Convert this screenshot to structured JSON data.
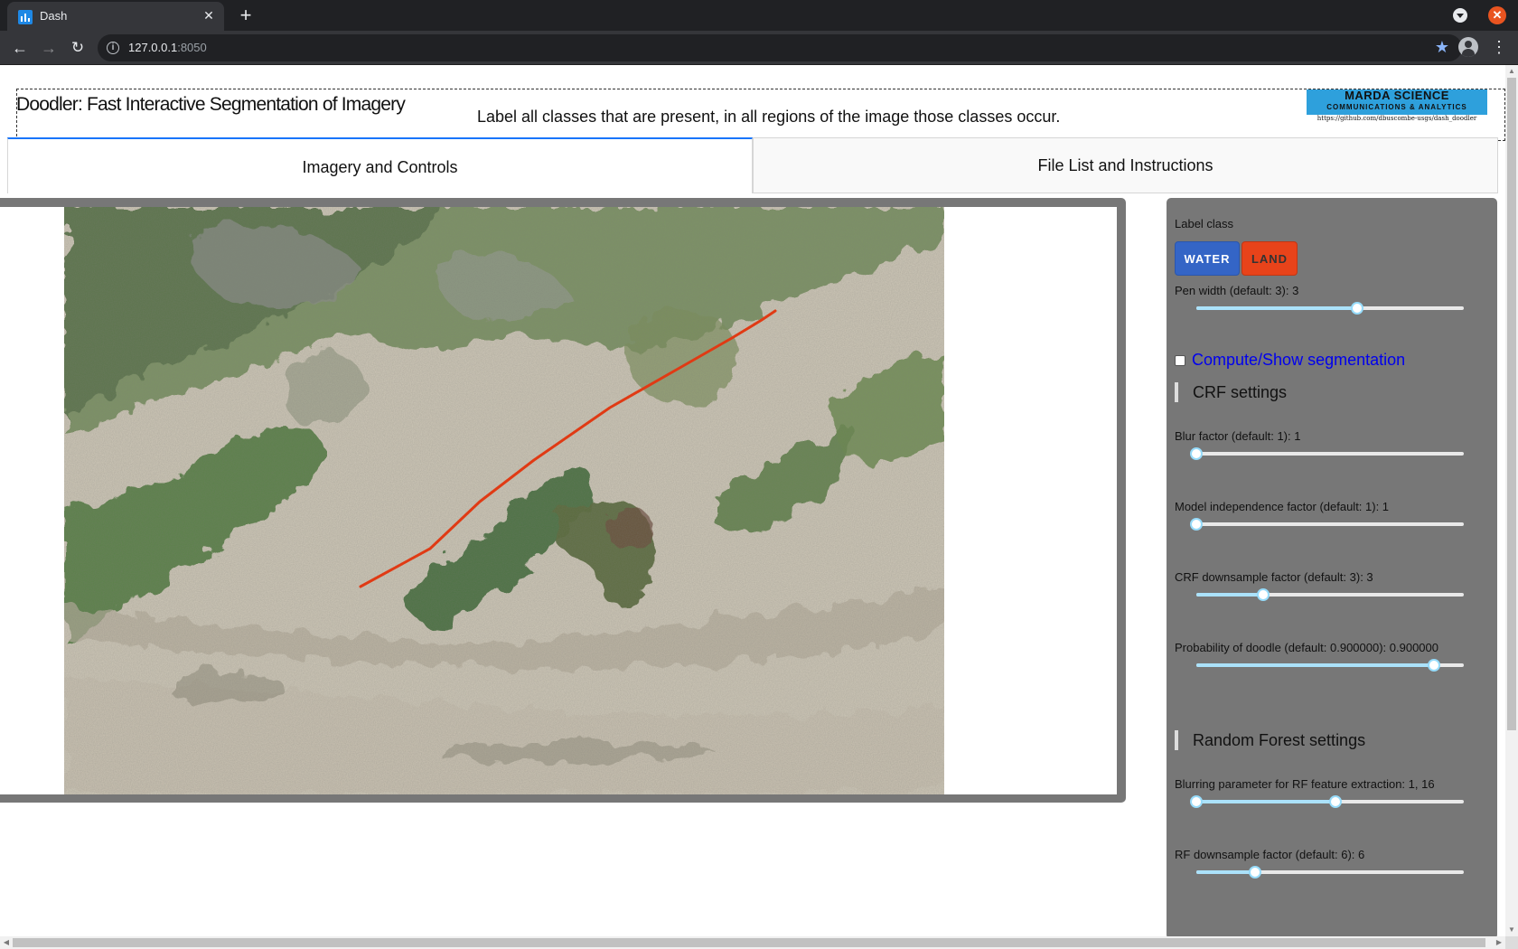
{
  "browser": {
    "tab_title": "Dash",
    "tab_close": "✕",
    "new_tab": "+",
    "url_host": "127.0.0.1",
    "url_port": ":8050"
  },
  "header": {
    "title": "Doodler: Fast Interactive Segmentation of Imagery",
    "instructions": "Label all classes that are present, in all regions of the image those classes occur.",
    "logo_line1": "MARDA SCIENCE",
    "logo_line2": "COMMUNICATIONS & ANALYTICS",
    "logo_url": "https://github.com/dbuscombe-usgs/dash_doodler"
  },
  "tabs": [
    {
      "label": "Imagery and Controls",
      "selected": true
    },
    {
      "label": "File List and Instructions",
      "selected": false
    }
  ],
  "controls": {
    "label_class_title": "Label class",
    "classes": [
      {
        "label": "WATER",
        "color": "#3465c6"
      },
      {
        "label": "LAND",
        "color": "#e8431a"
      }
    ],
    "pen_width": {
      "label": "Pen width (default: 3): 3",
      "fraction": 0.6
    },
    "compute_segmentation": {
      "label": "Compute/Show segmentation",
      "checked": false
    },
    "crf_section": "CRF settings",
    "blur_factor": {
      "label": "Blur factor (default: 1): 1",
      "fraction": 0.0
    },
    "model_independence": {
      "label": "Model independence factor (default: 1): 1",
      "fraction": 0.0
    },
    "crf_downsample": {
      "label": "CRF downsample factor (default: 3): 3",
      "fraction": 0.25
    },
    "doodle_probability": {
      "label": "Probability of doodle (default: 0.900000): 0.900000",
      "fraction": 0.89
    },
    "rf_section": "Random Forest settings",
    "rf_blur": {
      "label": "Blurring parameter for RF feature extraction: 1, 16",
      "range": [
        0.0,
        0.52
      ]
    },
    "rf_downsample": {
      "label": "RF downsample factor (default: 6): 6",
      "fraction": 0.22
    }
  },
  "doodle": {
    "class": "LAND",
    "color": "#e03a14"
  }
}
